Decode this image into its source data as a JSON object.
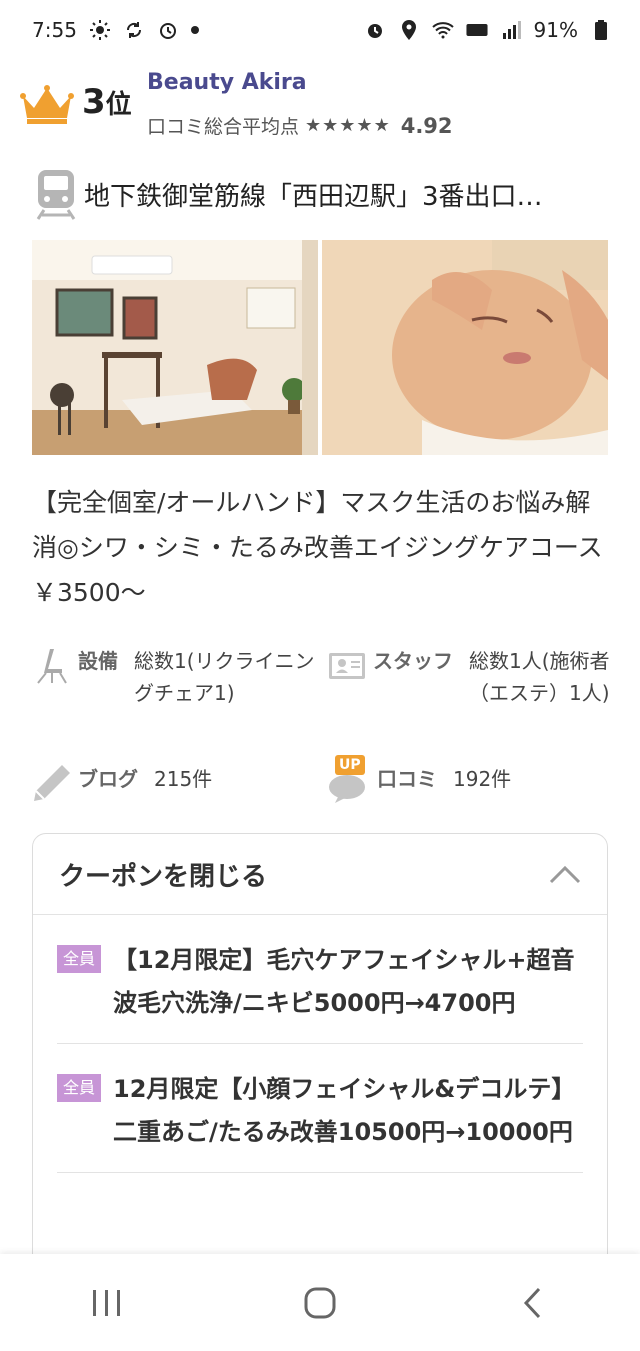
{
  "status_bar": {
    "time": "7:55",
    "battery": "91%"
  },
  "salon": {
    "rank_number": "3",
    "rank_unit": "位",
    "name": "Beauty Akira",
    "rating_label": "口コミ総合平均点",
    "stars": "★★★★★",
    "rating_value": "4.92",
    "access": "地下鉄御堂筋線「西田辺駅」3番出口…",
    "catch_copy": "【完全個室/オールハンド】マスク生活のお悩み解消◎シワ・シミ・たるみ改善エイジングケアコース￥3500〜"
  },
  "info": {
    "equipment_label": "設備",
    "equipment_value": "総数1(リクライニングチェア1)",
    "staff_label": "スタッフ",
    "staff_value": "総数1人(施術者（エステ）1人)",
    "blog_label": "ブログ",
    "blog_value": "215件",
    "review_badge": "UP",
    "review_label": "口コミ",
    "review_value": "192件"
  },
  "coupons": {
    "toggle_label": "クーポンを閉じる",
    "items": [
      {
        "badge": "全員",
        "text": "【12月限定】毛穴ケアフェイシャル+超音波毛穴洗浄/ニキビ5000円→4700円"
      },
      {
        "badge": "全員",
        "text": "12月限定【小顔フェイシャル&デコルテ】二重あご/たるみ改善10500円→10000円"
      }
    ]
  },
  "colors": {
    "accent_name": "#4a4a8e",
    "badge": "#c795d6",
    "crown": "#f0a030"
  }
}
